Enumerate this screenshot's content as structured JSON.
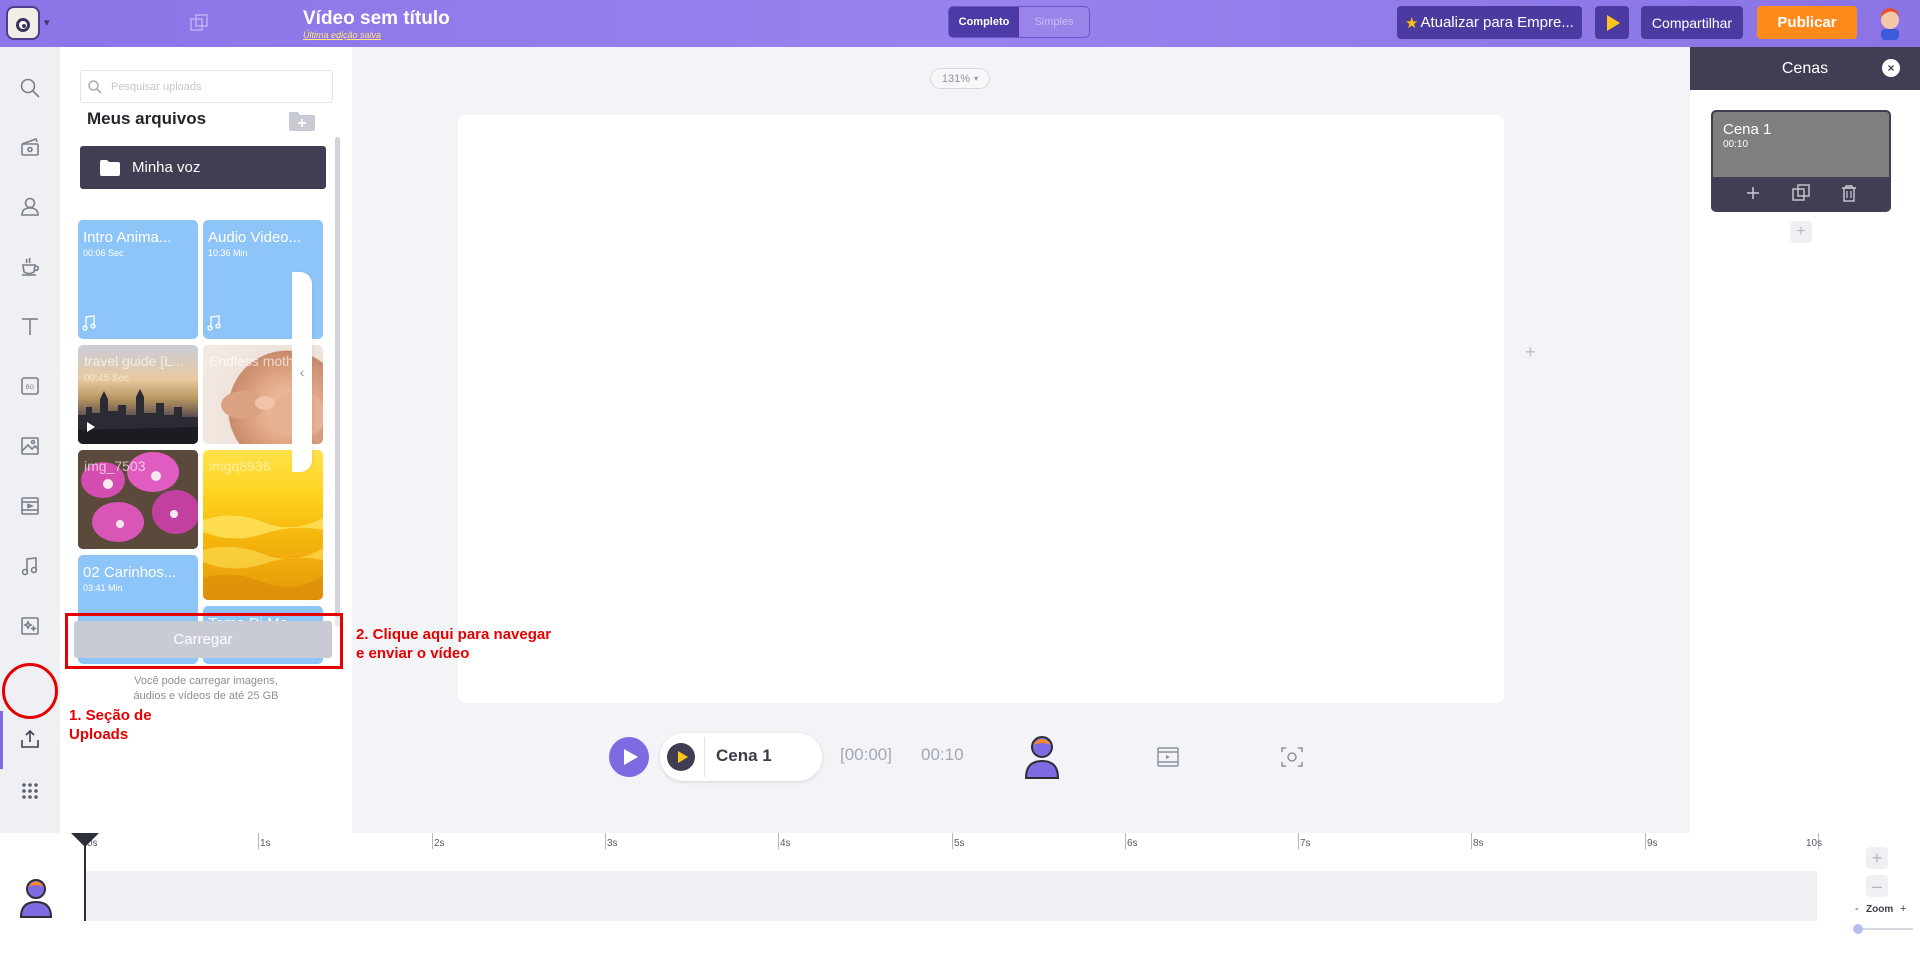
{
  "topbar": {
    "project_title": "Vídeo sem título",
    "project_subtitle": "Última edição salva",
    "mode_full": "Completo",
    "mode_simple": "Simples",
    "upgrade_label": "Atualizar para Empre...",
    "share_label": "Compartilhar",
    "publish_label": "Publicar",
    "accent_color": "#8b74e6",
    "publish_color": "#ff8a1c"
  },
  "sidebar": {
    "items": [
      {
        "name": "search-icon"
      },
      {
        "name": "scene-template-icon"
      },
      {
        "name": "character-icon"
      },
      {
        "name": "props-icon"
      },
      {
        "name": "text-icon"
      },
      {
        "name": "background-icon"
      },
      {
        "name": "image-icon"
      },
      {
        "name": "video-icon"
      },
      {
        "name": "music-icon"
      },
      {
        "name": "effects-icon"
      },
      {
        "name": "upload-icon",
        "active": true
      },
      {
        "name": "more-apps-icon"
      }
    ]
  },
  "uploads": {
    "search_placeholder": "Pesquisar uploads",
    "title": "Meus arquivos",
    "folder_label": "Minha voz",
    "files": [
      {
        "title": "Intro Anima...",
        "duration": "00:06 Sec",
        "kind": "audio"
      },
      {
        "title": "Audio Video...",
        "duration": "10:36 Min",
        "kind": "audio"
      },
      {
        "title": "travel guide [L...",
        "duration": "00:45 Sec",
        "kind": "video"
      },
      {
        "title": "Endless moth...",
        "duration": "",
        "kind": "image"
      },
      {
        "title": "img_7503",
        "duration": "",
        "kind": "image"
      },
      {
        "title": "imgq8936",
        "duration": "",
        "kind": "image"
      },
      {
        "title": "02 Carinhos...",
        "duration": "03:41 Min",
        "kind": "audio"
      },
      {
        "title": "Tema Di Ma...",
        "duration": "",
        "kind": "audio"
      }
    ],
    "upload_button": "Carregar",
    "hint_line1": "Você pode carregar imagens,",
    "hint_line2": "áudios e vídeos de até 25 GB"
  },
  "annotations": {
    "step1_line1": "1. Seção de",
    "step1_line2": "Uploads",
    "step2_line1": "2. Clique aqui para navegar",
    "step2_line2": "e enviar o vídeo"
  },
  "stage": {
    "zoom_level": "131%",
    "scene_name": "Cena 1",
    "time_current": "[00:00]",
    "time_total": "00:10"
  },
  "scenes": {
    "header": "Cenas",
    "list": [
      {
        "name": "Cena 1",
        "duration": "00:10"
      }
    ]
  },
  "timeline": {
    "ticks": [
      "0s",
      "1s",
      "2s",
      "3s",
      "4s",
      "5s",
      "6s",
      "7s",
      "8s",
      "9s",
      "10s"
    ],
    "zoom_label": "Zoom",
    "zoom_minus": "-",
    "zoom_plus": "+"
  }
}
